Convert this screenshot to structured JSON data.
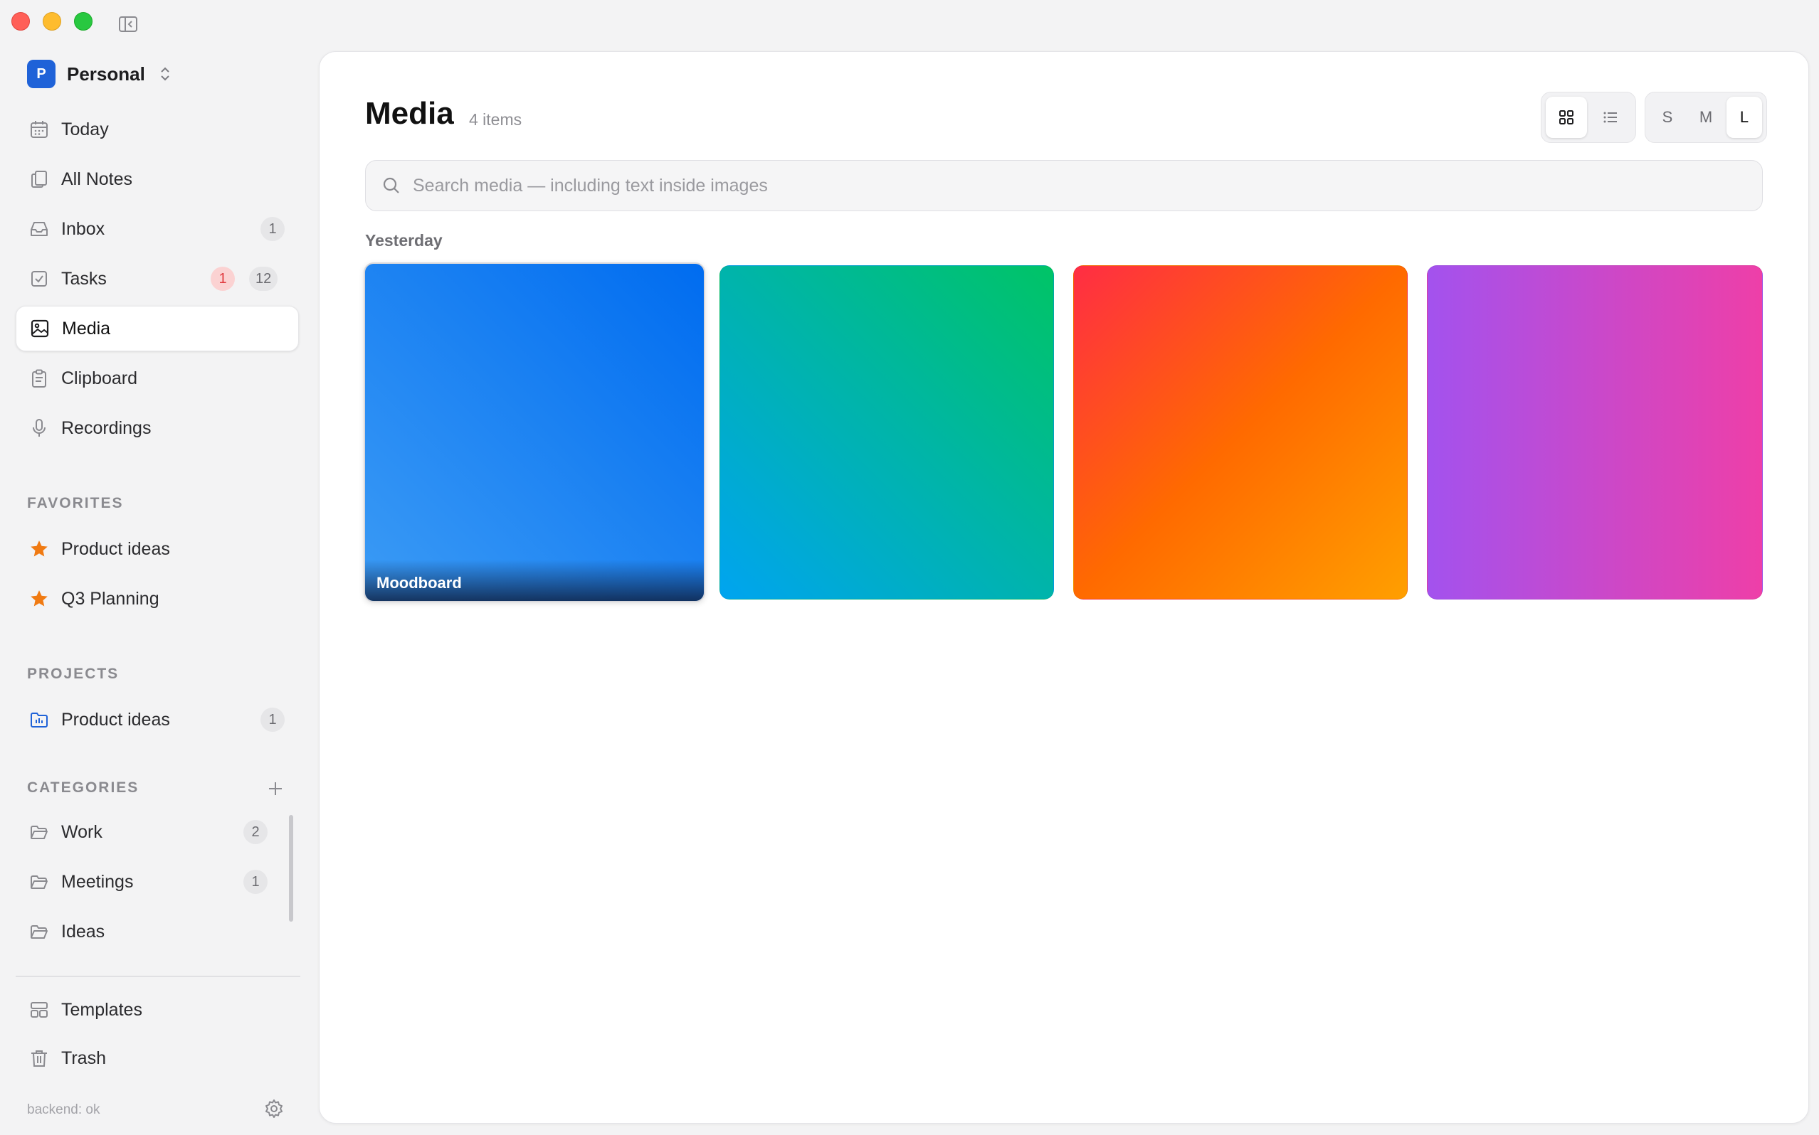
{
  "sidebar": {
    "workspace": {
      "initial": "P",
      "name": "Personal"
    },
    "nav": [
      {
        "label": "Today"
      },
      {
        "label": "All Notes"
      },
      {
        "label": "Inbox",
        "badge": "1"
      },
      {
        "label": "Tasks",
        "badge_alert": "1",
        "badge": "12"
      },
      {
        "label": "Media",
        "active": true
      },
      {
        "label": "Clipboard"
      },
      {
        "label": "Recordings"
      }
    ],
    "favorites": {
      "title": "FAVORITES",
      "items": [
        {
          "label": "Product ideas"
        },
        {
          "label": "Q3 Planning"
        }
      ]
    },
    "projects": {
      "title": "PROJECTS",
      "items": [
        {
          "label": "Product ideas",
          "badge": "1"
        }
      ]
    },
    "categories": {
      "title": "CATEGORIES",
      "items": [
        {
          "label": "Work",
          "badge": "2"
        },
        {
          "label": "Meetings",
          "badge": "1"
        },
        {
          "label": "Ideas"
        }
      ]
    },
    "footer_items": [
      {
        "label": "Templates"
      },
      {
        "label": "Trash"
      }
    ],
    "status": "backend: ok"
  },
  "main": {
    "title": "Media",
    "count": "4 items",
    "view_modes": {
      "selected": "grid"
    },
    "sizes": {
      "options": [
        "S",
        "M",
        "L"
      ],
      "selected": "L"
    },
    "search": {
      "placeholder": "Search media — including text inside images",
      "value": ""
    },
    "group_label": "Yesterday",
    "tiles": [
      {
        "caption": "Moodboard",
        "colors": [
          "#3b9bf5",
          "#006cf0"
        ]
      },
      {
        "caption": "",
        "colors": [
          "#00c466",
          "#00a4f0"
        ]
      },
      {
        "caption": "",
        "colors": [
          "#ff2d44",
          "#ff6a00",
          "#ff9f00"
        ]
      },
      {
        "caption": "",
        "colors": [
          "#a352ee",
          "#ee3fa8"
        ]
      }
    ]
  },
  "colors": {
    "accent": "#1f62d8",
    "star": "#f07a12",
    "alert": "#e0393e"
  }
}
